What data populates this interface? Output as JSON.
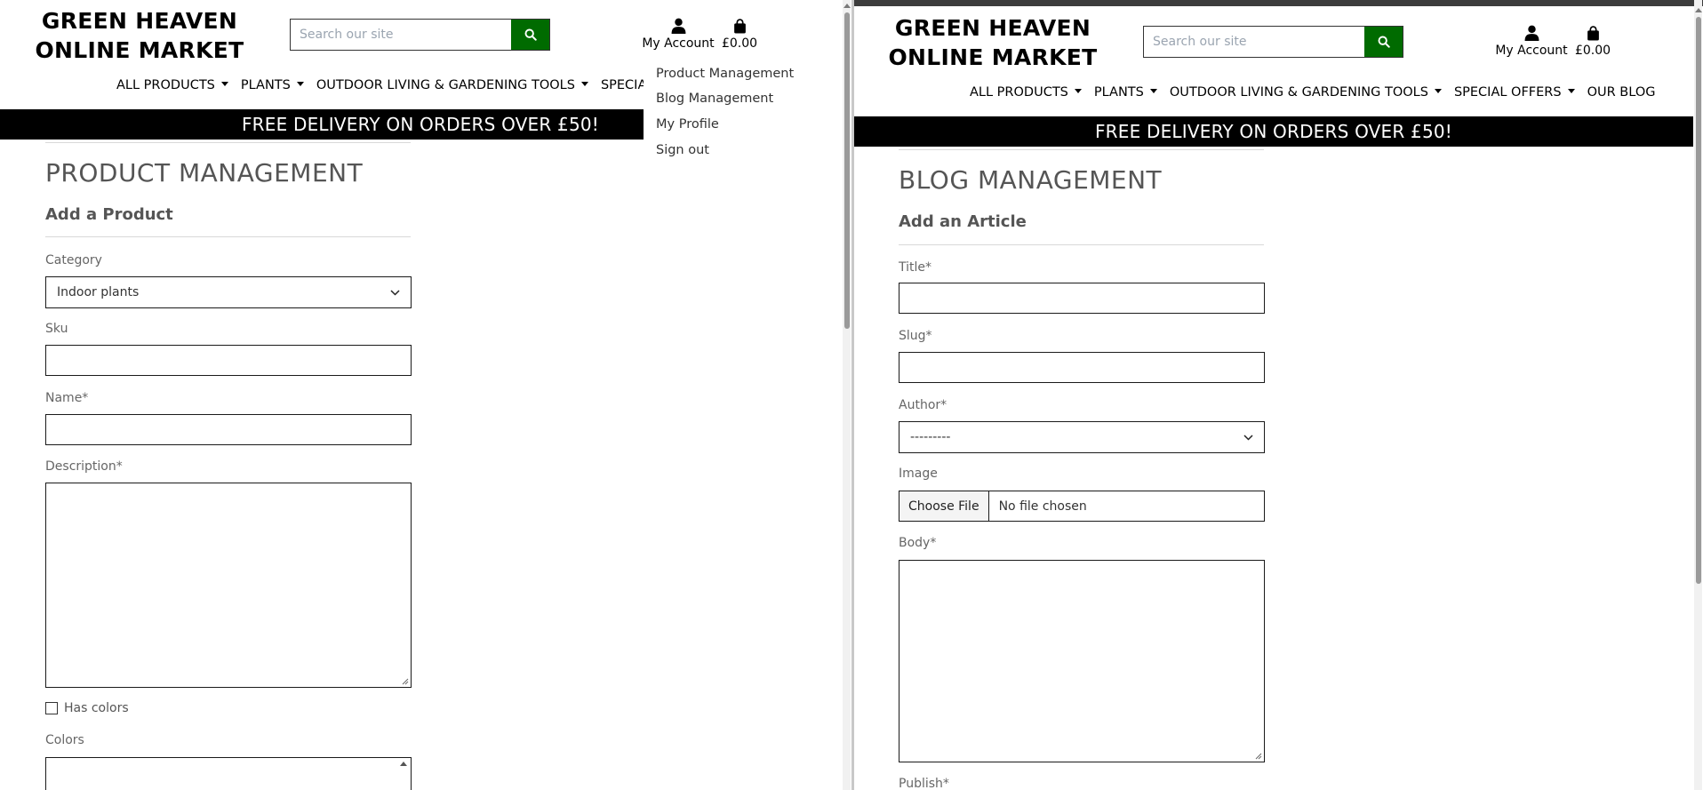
{
  "left": {
    "logo_line1": "GREEN HEAVEN",
    "logo_line2": "ONLINE MARKET",
    "search_placeholder": "Search our site",
    "account_label": "My Account",
    "bag_total": "£0.00",
    "nav": [
      "ALL PRODUCTS",
      "PLANTS",
      "OUTDOOR LIVING & GARDENING TOOLS",
      "SPECIAL OF"
    ],
    "banner": "FREE DELIVERY ON ORDERS OVER £50!",
    "page_title": "PRODUCT MANAGEMENT",
    "sub_title": "Add a Product",
    "category_label": "Category",
    "category_value": "Indoor plants",
    "sku_label": "Sku",
    "name_label": "Name*",
    "description_label": "Description*",
    "has_colors_label": "Has colors",
    "colors_label": "Colors",
    "account_menu": [
      "Product Management",
      "Blog Management",
      "My Profile",
      "Sign out"
    ]
  },
  "right": {
    "logo_line1": "GREEN HEAVEN",
    "logo_line2": "ONLINE MARKET",
    "search_placeholder": "Search our site",
    "account_label": "My Account",
    "bag_total": "£0.00",
    "nav": [
      "ALL PRODUCTS",
      "PLANTS",
      "OUTDOOR LIVING & GARDENING TOOLS",
      "SPECIAL OFFERS",
      "OUR BLOG"
    ],
    "nav_has_caret": [
      true,
      true,
      true,
      true,
      false
    ],
    "banner": "FREE DELIVERY ON ORDERS OVER £50!",
    "page_title": "BLOG MANAGEMENT",
    "sub_title": "Add an Article",
    "title_label": "Title*",
    "slug_label": "Slug*",
    "author_label": "Author*",
    "author_value": "---------",
    "image_label": "Image",
    "choose_file_label": "Choose File",
    "no_file_label": "No file chosen",
    "body_label": "Body*",
    "publish_label": "Publish*"
  },
  "colors": {
    "brand_green": "#006b00",
    "banner_bg": "#000000",
    "banner_text": "#ffffff"
  },
  "icons": [
    "search-icon",
    "user-icon",
    "shopping-bag-icon",
    "chevron-down-icon",
    "caret-down-icon"
  ]
}
